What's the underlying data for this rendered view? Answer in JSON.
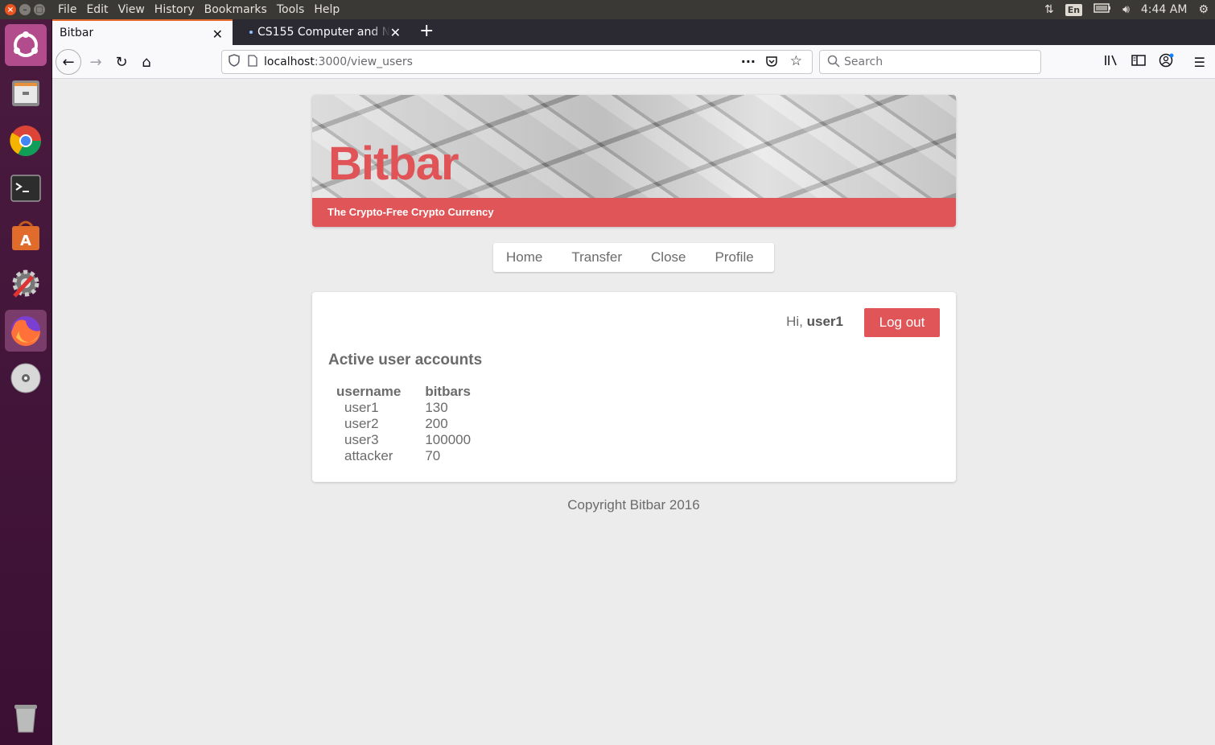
{
  "system": {
    "menu": [
      "File",
      "Edit",
      "View",
      "History",
      "Bookmarks",
      "Tools",
      "Help"
    ],
    "lang": "En",
    "time": "4:44 AM"
  },
  "browser": {
    "tabs": [
      {
        "title": "Bitbar"
      },
      {
        "title": "CS155 Computer and Ne"
      }
    ],
    "url_host": "localhost",
    "url_path": ":3000/view_users",
    "search_placeholder": "Search"
  },
  "site": {
    "title": "Bitbar",
    "tagline": "The Crypto-Free Crypto Currency",
    "nav": [
      "Home",
      "Transfer",
      "Close",
      "Profile"
    ]
  },
  "session": {
    "greeting_prefix": "Hi,",
    "username": "user1",
    "logout_label": "Log out"
  },
  "accounts": {
    "heading": "Active user accounts",
    "columns": [
      "username",
      "bitbars"
    ],
    "rows": [
      [
        "user1",
        "130"
      ],
      [
        "user2",
        "200"
      ],
      [
        "user3",
        "100000"
      ],
      [
        "attacker",
        "70"
      ]
    ]
  },
  "footer": {
    "copyright": "Copyright Bitbar 2016"
  },
  "colors": {
    "accent": "#df5558",
    "title": "#e05356",
    "page_bg": "#ececec"
  }
}
